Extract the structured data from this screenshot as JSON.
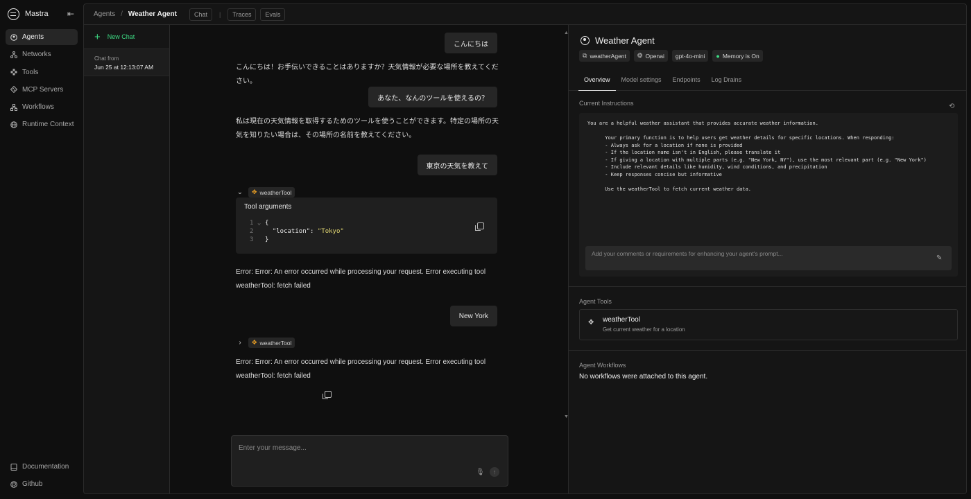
{
  "app": {
    "name": "Mastra",
    "collapse_icon": "collapse-sidebar-icon"
  },
  "nav": {
    "items": [
      {
        "label": "Agents",
        "icon": "agent-icon",
        "active": true
      },
      {
        "label": "Networks",
        "icon": "network-icon",
        "active": false
      },
      {
        "label": "Tools",
        "icon": "tools-icon",
        "active": false
      },
      {
        "label": "MCP Servers",
        "icon": "mcp-icon",
        "active": false
      },
      {
        "label": "Workflows",
        "icon": "workflow-icon",
        "active": false
      },
      {
        "label": "Runtime Context",
        "icon": "globe-icon",
        "active": false
      }
    ],
    "footer": [
      {
        "label": "Documentation",
        "icon": "book-icon"
      },
      {
        "label": "Github",
        "icon": "github-icon"
      }
    ]
  },
  "header": {
    "breadcrumb": {
      "root": "Agents",
      "sep": "/",
      "current": "Weather Agent"
    },
    "tabs": {
      "chat": "Chat",
      "divider": "|",
      "traces": "Traces",
      "evals": "Evals"
    }
  },
  "chats": {
    "new_chat": "New Chat",
    "entry": {
      "line1": "Chat from",
      "line2": "Jun 25 at 12:13:07 AM"
    }
  },
  "conversation": {
    "u1": "こんにちは",
    "a1": "こんにちは！お手伝いできることはありますか？天気情報が必要な場所を教えてください。",
    "u2": "あなた、なんのツールを使えるの？",
    "a2": "私は現在の天気情報を取得するためのツールを使うことができます。特定の場所の天気を知りたい場合は、その場所の名前を教えてください。",
    "u3": "東京の天気を教えて",
    "tool1": {
      "name": "weatherTool",
      "expanded": true,
      "title": "Tool arguments",
      "code": {
        "l1": "1",
        "l2": "2",
        "l3": "3",
        "fold": "⌄",
        "open": "{",
        "key": "\"location\"",
        "colon": ": ",
        "value": "\"Tokyo\"",
        "close": "}"
      }
    },
    "a3": "Error: Error: An error occurred while processing your request. Error executing tool weatherTool: fetch failed",
    "u4": "New York",
    "tool2": {
      "name": "weatherTool",
      "expanded": false
    },
    "a4": "Error: Error: An error occurred while processing your request. Error executing tool weatherTool: fetch failed"
  },
  "composer": {
    "placeholder": "Enter your message..."
  },
  "agent": {
    "title": "Weather Agent",
    "badges": {
      "id": "weatherAgent",
      "provider": "Openai",
      "model": "gpt-4o-mini",
      "memory": "Memory is On"
    },
    "tabs": {
      "overview": "Overview",
      "model": "Model settings",
      "endpoints": "Endpoints",
      "logs": "Log Drains"
    },
    "instructions_label": "Current Instructions",
    "instructions": "You are a helpful weather assistant that provides accurate weather information.\n\n      Your primary function is to help users get weather details for specific locations. When responding:\n      - Always ask for a location if none is provided\n      - If the location name isn't in English, please translate it\n      - If giving a location with multiple parts (e.g. \"New York, NY\"), use the most relevant part (e.g. \"New York\")\n      - Include relevant details like humidity, wind conditions, and precipitation\n      - Keep responses concise but informative\n\n      Use the weatherTool to fetch current weather data.",
    "enhance_placeholder": "Add your comments or requirements for enhancing your agent's prompt...",
    "tools_label": "Agent Tools",
    "tool": {
      "name": "weatherTool",
      "desc": "Get current weather for a location"
    },
    "workflows_label": "Agent Workflows",
    "workflows_empty": "No workflows were attached to this agent."
  },
  "colors": {
    "accent_green": "#3ddc84",
    "tool_orange": "#f5a623"
  }
}
